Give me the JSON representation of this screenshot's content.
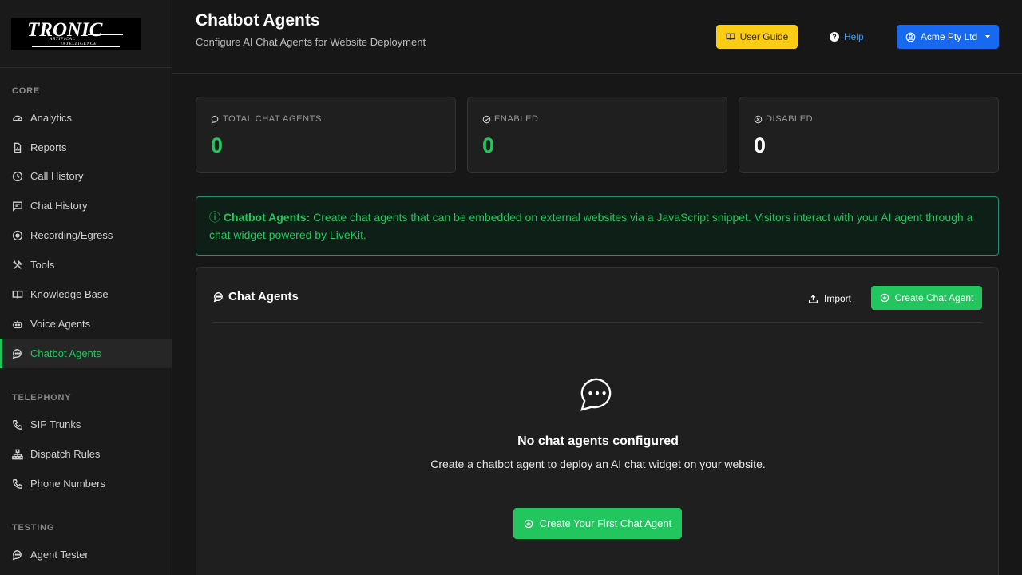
{
  "logo": {
    "main": "TRONIC",
    "sub_line1": "ARTIFICAL",
    "sub_line2": "INTELLIGENCE"
  },
  "sidebar": {
    "sections": [
      {
        "label": "CORE"
      },
      {
        "label": "TELEPHONY"
      },
      {
        "label": "TESTING"
      }
    ],
    "items": [
      {
        "label": "Analytics",
        "icon": "gauge-icon"
      },
      {
        "label": "Reports",
        "icon": "report-icon"
      },
      {
        "label": "Call History",
        "icon": "clock-icon"
      },
      {
        "label": "Chat History",
        "icon": "chat-list-icon"
      },
      {
        "label": "Recording/Egress",
        "icon": "record-icon"
      },
      {
        "label": "Tools",
        "icon": "tools-icon"
      },
      {
        "label": "Knowledge Base",
        "icon": "book-icon"
      },
      {
        "label": "Voice Agents",
        "icon": "robot-icon"
      },
      {
        "label": "Chatbot Agents",
        "icon": "chat-dots-icon",
        "active": true
      },
      {
        "label": "SIP Trunks",
        "icon": "phone-icon"
      },
      {
        "label": "Dispatch Rules",
        "icon": "diagram-icon"
      },
      {
        "label": "Phone Numbers",
        "icon": "phone-icon"
      },
      {
        "label": "Agent Tester",
        "icon": "chat-dots-icon"
      }
    ]
  },
  "header": {
    "title": "Chatbot Agents",
    "subtitle": "Configure AI Chat Agents for Website Deployment",
    "user_guide_label": "User Guide",
    "help_label": "Help",
    "account_label": "Acme Pty Ltd"
  },
  "stats": [
    {
      "label": "TOTAL CHAT AGENTS",
      "value": "0",
      "color": "#22c55e"
    },
    {
      "label": "ENABLED",
      "value": "0",
      "color": "#22c55e"
    },
    {
      "label": "DISABLED",
      "value": "0",
      "color": "#ffffff"
    }
  ],
  "info": {
    "title": "Chatbot Agents:",
    "text": " Create chat agents that can be embedded on external websites via a JavaScript snippet. Visitors interact with your AI agent through a chat widget powered by LiveKit."
  },
  "panel": {
    "title": "Chat Agents",
    "import_label": "Import",
    "create_label": "Create Chat Agent",
    "empty_title": "No chat agents configured",
    "empty_text": "Create a chatbot agent to deploy an AI chat widget on your website.",
    "first_label": "Create Your First Chat Agent"
  },
  "colors": {
    "accent": "#22c55e",
    "primary": "#1769f0",
    "warning": "#facc15",
    "link": "#3b9cf5"
  }
}
